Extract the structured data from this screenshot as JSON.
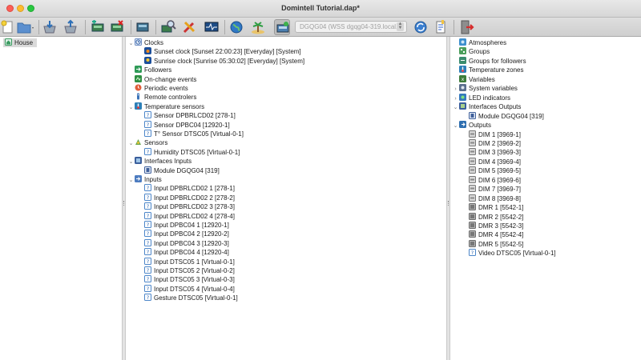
{
  "window": {
    "title": "Domintell Tutorial.dap*"
  },
  "toolbar": {
    "module_select_value": "DGQG04 (WSS dgqg04-319.local.)",
    "icons": [
      "new-file-icon",
      "open-folder-icon",
      "import-icon",
      "export-icon",
      "module-add-icon",
      "module-remove-icon",
      "module-icon",
      "search-module-icon",
      "tools-icon",
      "monitor-icon",
      "globe-icon",
      "island-icon",
      "connect-icon",
      "refresh-icon",
      "document-icon",
      "exit-icon"
    ]
  },
  "left_tree": {
    "root": {
      "label": "House",
      "icon": "house-icon"
    }
  },
  "middle_tree": [
    {
      "label": "Clocks",
      "level": 0,
      "expander": "open",
      "icon": "clock-icon"
    },
    {
      "label": "Sunset clock [Sunset 22:00:23] [Everyday] [System]",
      "level": 1,
      "expander": "none",
      "icon": "sunset-clock-icon"
    },
    {
      "label": "Sunrise clock [Sunrise 05:30:02] [Everyday] [System]",
      "level": 1,
      "expander": "none",
      "icon": "sunrise-clock-icon"
    },
    {
      "label": "Followers",
      "level": 0,
      "expander": "none",
      "icon": "followers-icon"
    },
    {
      "label": "On-change events",
      "level": 0,
      "expander": "none",
      "icon": "on-change-events-icon"
    },
    {
      "label": "Periodic events",
      "level": 0,
      "expander": "none",
      "icon": "periodic-events-icon"
    },
    {
      "label": "Remote controlers",
      "level": 0,
      "expander": "none",
      "icon": "remote-icon"
    },
    {
      "label": "Temperature sensors",
      "level": 0,
      "expander": "open",
      "icon": "thermometer-icon"
    },
    {
      "label": "Sensor DPBRLCD02 [278-1]",
      "level": 1,
      "expander": "none",
      "icon": "unknown-module-icon"
    },
    {
      "label": "Sensor DPBC04 [12920-1]",
      "level": 1,
      "expander": "none",
      "icon": "unknown-module-icon"
    },
    {
      "label": "T° Sensor DTSC05 [Virtual-0-1]",
      "level": 1,
      "expander": "none",
      "icon": "unknown-module-icon"
    },
    {
      "label": "Sensors",
      "level": 0,
      "expander": "open",
      "icon": "sensors-icon"
    },
    {
      "label": "Humidity DTSC05 [Virtual-0-1]",
      "level": 1,
      "expander": "none",
      "icon": "unknown-module-icon"
    },
    {
      "label": "Interfaces Inputs",
      "level": 0,
      "expander": "open",
      "icon": "interface-inputs-icon"
    },
    {
      "label": "Module DGQG04 [319]",
      "level": 1,
      "expander": "none",
      "icon": "interface-module-icon"
    },
    {
      "label": "Inputs",
      "level": 0,
      "expander": "open",
      "icon": "inputs-icon"
    },
    {
      "label": "Input DPBRLCD02 1 [278-1]",
      "level": 1,
      "expander": "none",
      "icon": "unknown-module-icon"
    },
    {
      "label": "Input DPBRLCD02 2 [278-2]",
      "level": 1,
      "expander": "none",
      "icon": "unknown-module-icon"
    },
    {
      "label": "Input DPBRLCD02 3 [278-3]",
      "level": 1,
      "expander": "none",
      "icon": "unknown-module-icon"
    },
    {
      "label": "Input DPBRLCD02 4 [278-4]",
      "level": 1,
      "expander": "none",
      "icon": "unknown-module-icon"
    },
    {
      "label": "Input DPBC04 1 [12920-1]",
      "level": 1,
      "expander": "none",
      "icon": "unknown-module-icon"
    },
    {
      "label": "Input DPBC04 2 [12920-2]",
      "level": 1,
      "expander": "none",
      "icon": "unknown-module-icon"
    },
    {
      "label": "Input DPBC04 3 [12920-3]",
      "level": 1,
      "expander": "none",
      "icon": "unknown-module-icon"
    },
    {
      "label": "Input DPBC04 4 [12920-4]",
      "level": 1,
      "expander": "none",
      "icon": "unknown-module-icon"
    },
    {
      "label": "Input DTSC05 1 [Virtual-0-1]",
      "level": 1,
      "expander": "none",
      "icon": "unknown-module-icon"
    },
    {
      "label": "Input DTSC05 2 [Virtual-0-2]",
      "level": 1,
      "expander": "none",
      "icon": "unknown-module-icon"
    },
    {
      "label": "Input DTSC05 3 [Virtual-0-3]",
      "level": 1,
      "expander": "none",
      "icon": "unknown-module-icon"
    },
    {
      "label": "Input DTSC05 4 [Virtual-0-4]",
      "level": 1,
      "expander": "none",
      "icon": "unknown-module-icon"
    },
    {
      "label": "Gesture DTSC05 [Virtual-0-1]",
      "level": 1,
      "expander": "none",
      "icon": "unknown-module-icon"
    }
  ],
  "right_tree": [
    {
      "label": "Atmospheres",
      "level": 0,
      "expander": "none",
      "icon": "atmospheres-icon"
    },
    {
      "label": "Groups",
      "level": 0,
      "expander": "none",
      "icon": "groups-icon"
    },
    {
      "label": "Groups for followers",
      "level": 0,
      "expander": "none",
      "icon": "groups-followers-icon"
    },
    {
      "label": "Temperature zones",
      "level": 0,
      "expander": "none",
      "icon": "temperature-zones-icon"
    },
    {
      "label": "Variables",
      "level": 0,
      "expander": "none",
      "icon": "variables-icon"
    },
    {
      "label": "System variables",
      "level": 0,
      "expander": "closed",
      "icon": "system-variables-icon"
    },
    {
      "label": "LED indicators",
      "level": 0,
      "expander": "closed",
      "icon": "led-indicators-icon"
    },
    {
      "label": "Interfaces Outputs",
      "level": 0,
      "expander": "open",
      "icon": "interface-outputs-icon"
    },
    {
      "label": "Module DGQG04 [319]",
      "level": 1,
      "expander": "none",
      "icon": "interface-module-icon"
    },
    {
      "label": "Outputs",
      "level": 0,
      "expander": "open",
      "icon": "outputs-icon"
    },
    {
      "label": "DIM 1 [3969-1]",
      "level": 1,
      "expander": "none",
      "icon": "dimmer-icon"
    },
    {
      "label": "DIM 2 [3969-2]",
      "level": 1,
      "expander": "none",
      "icon": "dimmer-icon"
    },
    {
      "label": "DIM 3 [3969-3]",
      "level": 1,
      "expander": "none",
      "icon": "dimmer-icon"
    },
    {
      "label": "DIM 4 [3969-4]",
      "level": 1,
      "expander": "none",
      "icon": "dimmer-icon"
    },
    {
      "label": "DIM 5 [3969-5]",
      "level": 1,
      "expander": "none",
      "icon": "dimmer-icon"
    },
    {
      "label": "DIM 6 [3969-6]",
      "level": 1,
      "expander": "none",
      "icon": "dimmer-icon"
    },
    {
      "label": "DIM 7 [3969-7]",
      "level": 1,
      "expander": "none",
      "icon": "dimmer-icon"
    },
    {
      "label": "DIM 8 [3969-8]",
      "level": 1,
      "expander": "none",
      "icon": "dimmer-icon"
    },
    {
      "label": "DMR 1 [5542-1]",
      "level": 1,
      "expander": "none",
      "icon": "relay-icon"
    },
    {
      "label": "DMR 2 [5542-2]",
      "level": 1,
      "expander": "none",
      "icon": "relay-icon"
    },
    {
      "label": "DMR 3 [5542-3]",
      "level": 1,
      "expander": "none",
      "icon": "relay-icon"
    },
    {
      "label": "DMR 4 [5542-4]",
      "level": 1,
      "expander": "none",
      "icon": "relay-icon"
    },
    {
      "label": "DMR 5 [5542-5]",
      "level": 1,
      "expander": "none",
      "icon": "relay-icon"
    },
    {
      "label": "Video DTSC05 [Virtual-0-1]",
      "level": 1,
      "expander": "none",
      "icon": "unknown-module-icon"
    }
  ]
}
